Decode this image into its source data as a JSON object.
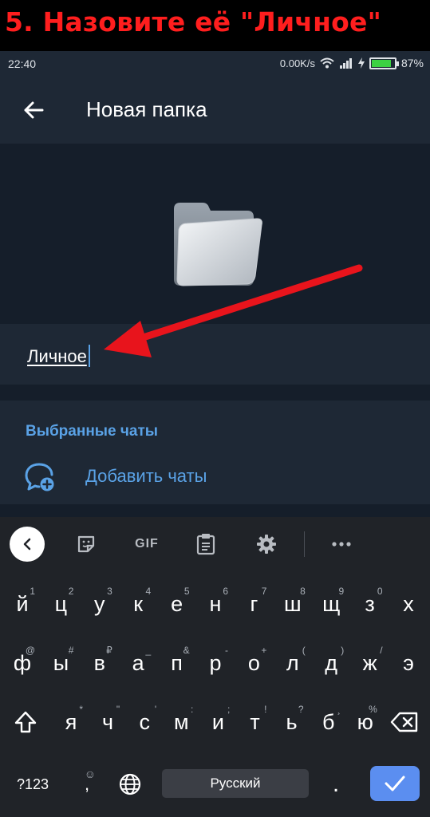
{
  "banner": {
    "text": "5. Назовите её \"Личное\""
  },
  "status_bar": {
    "time": "22:40",
    "speed": "0.00K/s",
    "battery": "87%",
    "battery_level": 0.87
  },
  "toolbar": {
    "title": "Новая папка",
    "back_icon": "arrow-left-icon"
  },
  "folder": {
    "icon": "folder-icon",
    "name_value": "Личное"
  },
  "chats": {
    "header": "Выбранные чаты",
    "add_label": "Добавить чаты",
    "add_icon": "chat-add-icon"
  },
  "keyboard": {
    "toolbar": {
      "gif_label": "GIF"
    },
    "rows": [
      [
        {
          "k": "й",
          "h": "1"
        },
        {
          "k": "ц",
          "h": "2"
        },
        {
          "k": "у",
          "h": "3"
        },
        {
          "k": "к",
          "h": "4"
        },
        {
          "k": "е",
          "h": "5"
        },
        {
          "k": "н",
          "h": "6"
        },
        {
          "k": "г",
          "h": "7"
        },
        {
          "k": "ш",
          "h": "8"
        },
        {
          "k": "щ",
          "h": "9"
        },
        {
          "k": "з",
          "h": "0"
        },
        {
          "k": "х",
          "h": ""
        }
      ],
      [
        {
          "k": "ф",
          "h": "@"
        },
        {
          "k": "ы",
          "h": "#"
        },
        {
          "k": "в",
          "h": "₽"
        },
        {
          "k": "а",
          "h": "_"
        },
        {
          "k": "п",
          "h": "&"
        },
        {
          "k": "р",
          "h": "-"
        },
        {
          "k": "о",
          "h": "+"
        },
        {
          "k": "л",
          "h": "("
        },
        {
          "k": "д",
          "h": ")"
        },
        {
          "k": "ж",
          "h": "/"
        },
        {
          "k": "э",
          "h": ""
        }
      ],
      [
        {
          "k": "я",
          "h": "*"
        },
        {
          "k": "ч",
          "h": "\""
        },
        {
          "k": "с",
          "h": "'"
        },
        {
          "k": "м",
          "h": ":"
        },
        {
          "k": "и",
          "h": ";"
        },
        {
          "k": "т",
          "h": "!"
        },
        {
          "k": "ь",
          "h": "?"
        },
        {
          "k": "б",
          "h": "¸"
        },
        {
          "k": "ю",
          "h": "%"
        }
      ]
    ],
    "symbols_label": "?123",
    "space_label": "Русский",
    "accent": "#5b8ef0"
  },
  "colors": {
    "banner_text": "#ff1e1e",
    "accent": "#5aa2e6",
    "arrow": "#e8141c",
    "toolbar_bg": "#1e2835",
    "panel_bg": "#151e2a"
  }
}
